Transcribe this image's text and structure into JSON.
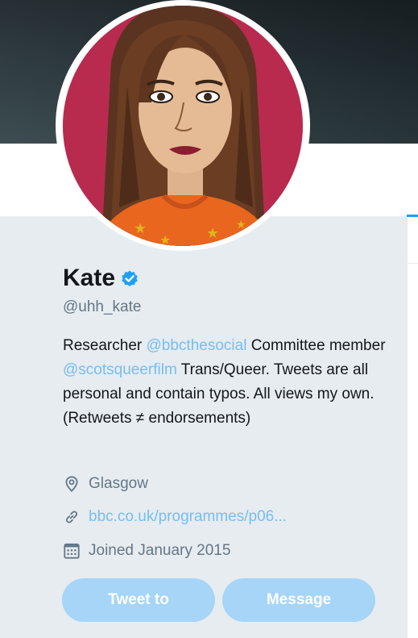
{
  "profile": {
    "name": "Kate",
    "handle": "@uhh_kate",
    "bio": {
      "part1": "Researcher ",
      "mention1": "@bbcthesocial",
      "part2": " Committee member ",
      "mention2": "@scotsqueerfilm",
      "part3": " Trans/Queer. Tweets are all personal and contain typos. All views my own. (Retweets ≠ endorsements)"
    },
    "location": "Glasgow",
    "website": "bbc.co.uk/programmes/p06...",
    "joined": "Joined January 2015"
  },
  "actions": {
    "tweet_to": "Tweet to",
    "message": "Message"
  },
  "icons": {
    "verified": "verified-badge-icon",
    "location": "location-pin-icon",
    "link": "link-icon",
    "calendar": "calendar-icon"
  },
  "colors": {
    "accent": "#1da1f2",
    "link": "#77bdf0",
    "button_disabled": "#a6d5f8",
    "card_background": "#e6ecf0",
    "secondary_text": "#657786",
    "primary_text": "#14171a"
  }
}
